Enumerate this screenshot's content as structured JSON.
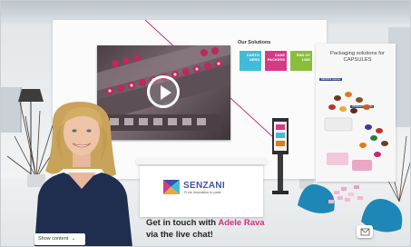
{
  "video": {
    "play_icon": "play-icon",
    "accent_color": "#c0265f"
  },
  "solutions": {
    "title": "Our Solutions",
    "tiles": [
      {
        "label": "CARTO NERS",
        "color": "#41bcd8"
      },
      {
        "label": "CASE PACKERS",
        "color": "#d63a86"
      },
      {
        "label": "END OF LINE",
        "color": "#8bbd3d"
      }
    ]
  },
  "capsules_panel": {
    "title": "Packaging solutions for CAPSULES",
    "caption_1": "SENZANI capsule",
    "caption_2": "PRODUCT capsule"
  },
  "counter": {
    "brand_name": "SENZANI",
    "brand_tagline": "From innovation to pack",
    "brand_color": "#3f53a4"
  },
  "chat_prompt": {
    "line1_prefix": "Get in touch with ",
    "host_name": "Adele Rava",
    "line2": "via the live chat!",
    "host_color": "#cf2e7f"
  },
  "controls": {
    "show_content_label": "Show content",
    "show_content_icon": "chevron-down-icon",
    "mail_icon": "envelope-icon"
  }
}
